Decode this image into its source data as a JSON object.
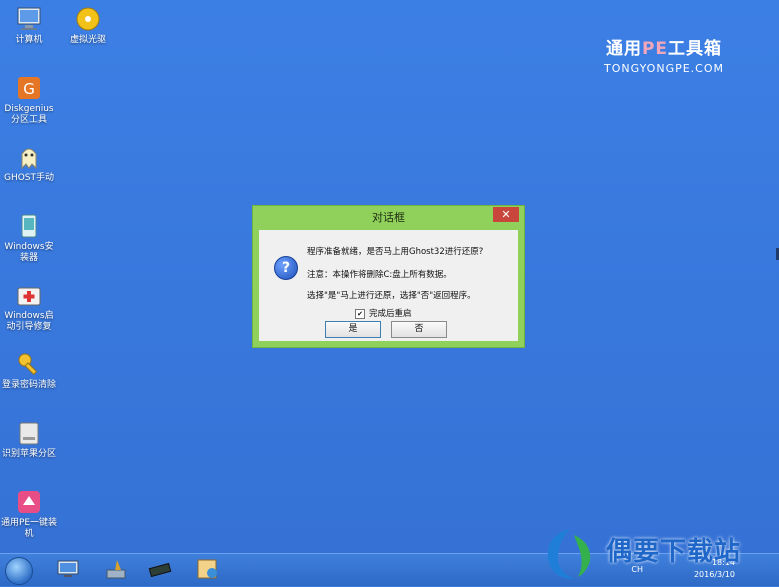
{
  "desktop_icons": [
    {
      "label": "计算机"
    },
    {
      "label": "虚拟光驱"
    },
    {
      "label": "Diskgenius分区工具"
    },
    {
      "label": "GHOST手动"
    },
    {
      "label": "Windows安装器"
    },
    {
      "label": "Windows启动引导修复"
    },
    {
      "label": "登录密码清除"
    },
    {
      "label": "识别苹果分区"
    },
    {
      "label": "通用PE一键装机"
    }
  ],
  "brand": {
    "name_prefix": "通用",
    "name_pe": "PE",
    "name_suffix": "工具箱",
    "url": "TONGYONGPE.COM"
  },
  "dialog": {
    "title": "对话框",
    "close_label": "✕",
    "line1": "程序准备就绪，是否马上用Ghost32进行还原?",
    "line2": "注意：本操作将删除C:盘上所有数据。",
    "line3": "选择\"是\"马上进行还原，选择\"否\"返回程序。",
    "checkbox_label": "完成后重启",
    "checkbox_checked": true,
    "checkbox_mark": "✔",
    "yes_label": "是",
    "no_label": "否"
  },
  "taskbar": {
    "lang": "CH",
    "time": "18:14",
    "date": "2016/3/10"
  },
  "watermark": {
    "text": "偶要下载站"
  }
}
